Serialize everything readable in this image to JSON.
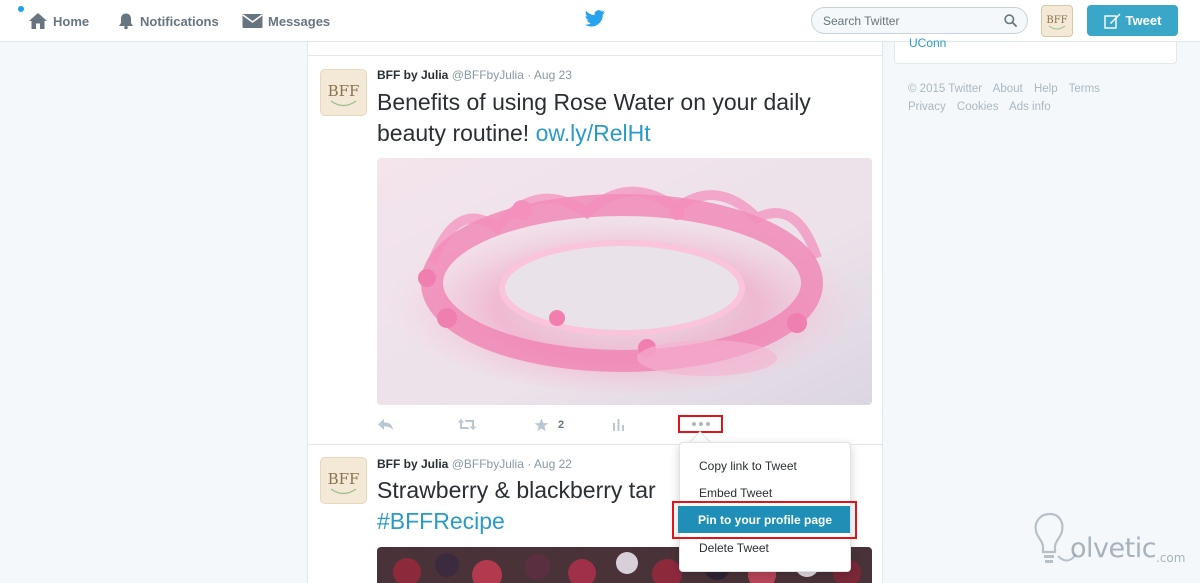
{
  "nav": {
    "home_label": "Home",
    "notifications_label": "Notifications",
    "messages_label": "Messages",
    "search_placeholder": "Search Twitter",
    "tweet_button_label": "Tweet"
  },
  "timeline": {
    "tweets": [
      {
        "avatar_text": "BFF",
        "name": "BFF by Julia",
        "handle": "@BFFbyJulia",
        "separator": "·",
        "date": "Aug 23",
        "text": "Benefits of using Rose Water on your daily beauty routine!",
        "link": "ow.ly/RelHt",
        "media_description": "pink water splash",
        "favorites_count": "2"
      },
      {
        "avatar_text": "BFF",
        "name": "BFF by Julia",
        "handle": "@BFFbyJulia",
        "separator": "·",
        "date": "Aug 22",
        "text": "Strawberry & blackberry tar",
        "hashtag": "#BFFRecipe",
        "media_description": "berries tart"
      }
    ]
  },
  "more_menu": {
    "items": [
      {
        "label": "Copy link to Tweet"
      },
      {
        "label": "Embed Tweet"
      },
      {
        "label": "Pin to your profile page",
        "active": true
      },
      {
        "label": "Delete Tweet"
      }
    ]
  },
  "sidebar": {
    "trend_tail": "UConn",
    "footer_line1": [
      "© 2015 Twitter",
      "About",
      "Help",
      "Terms"
    ],
    "footer_line2": [
      "Privacy",
      "Cookies",
      "Ads info"
    ]
  },
  "watermark": {
    "text": "olvetic",
    "suffix": ".com"
  },
  "colors": {
    "accent": "#3aa7c9",
    "link": "#2a9ac8",
    "highlight_outline": "#e3131c",
    "menu_active": "#1f8fb8"
  }
}
